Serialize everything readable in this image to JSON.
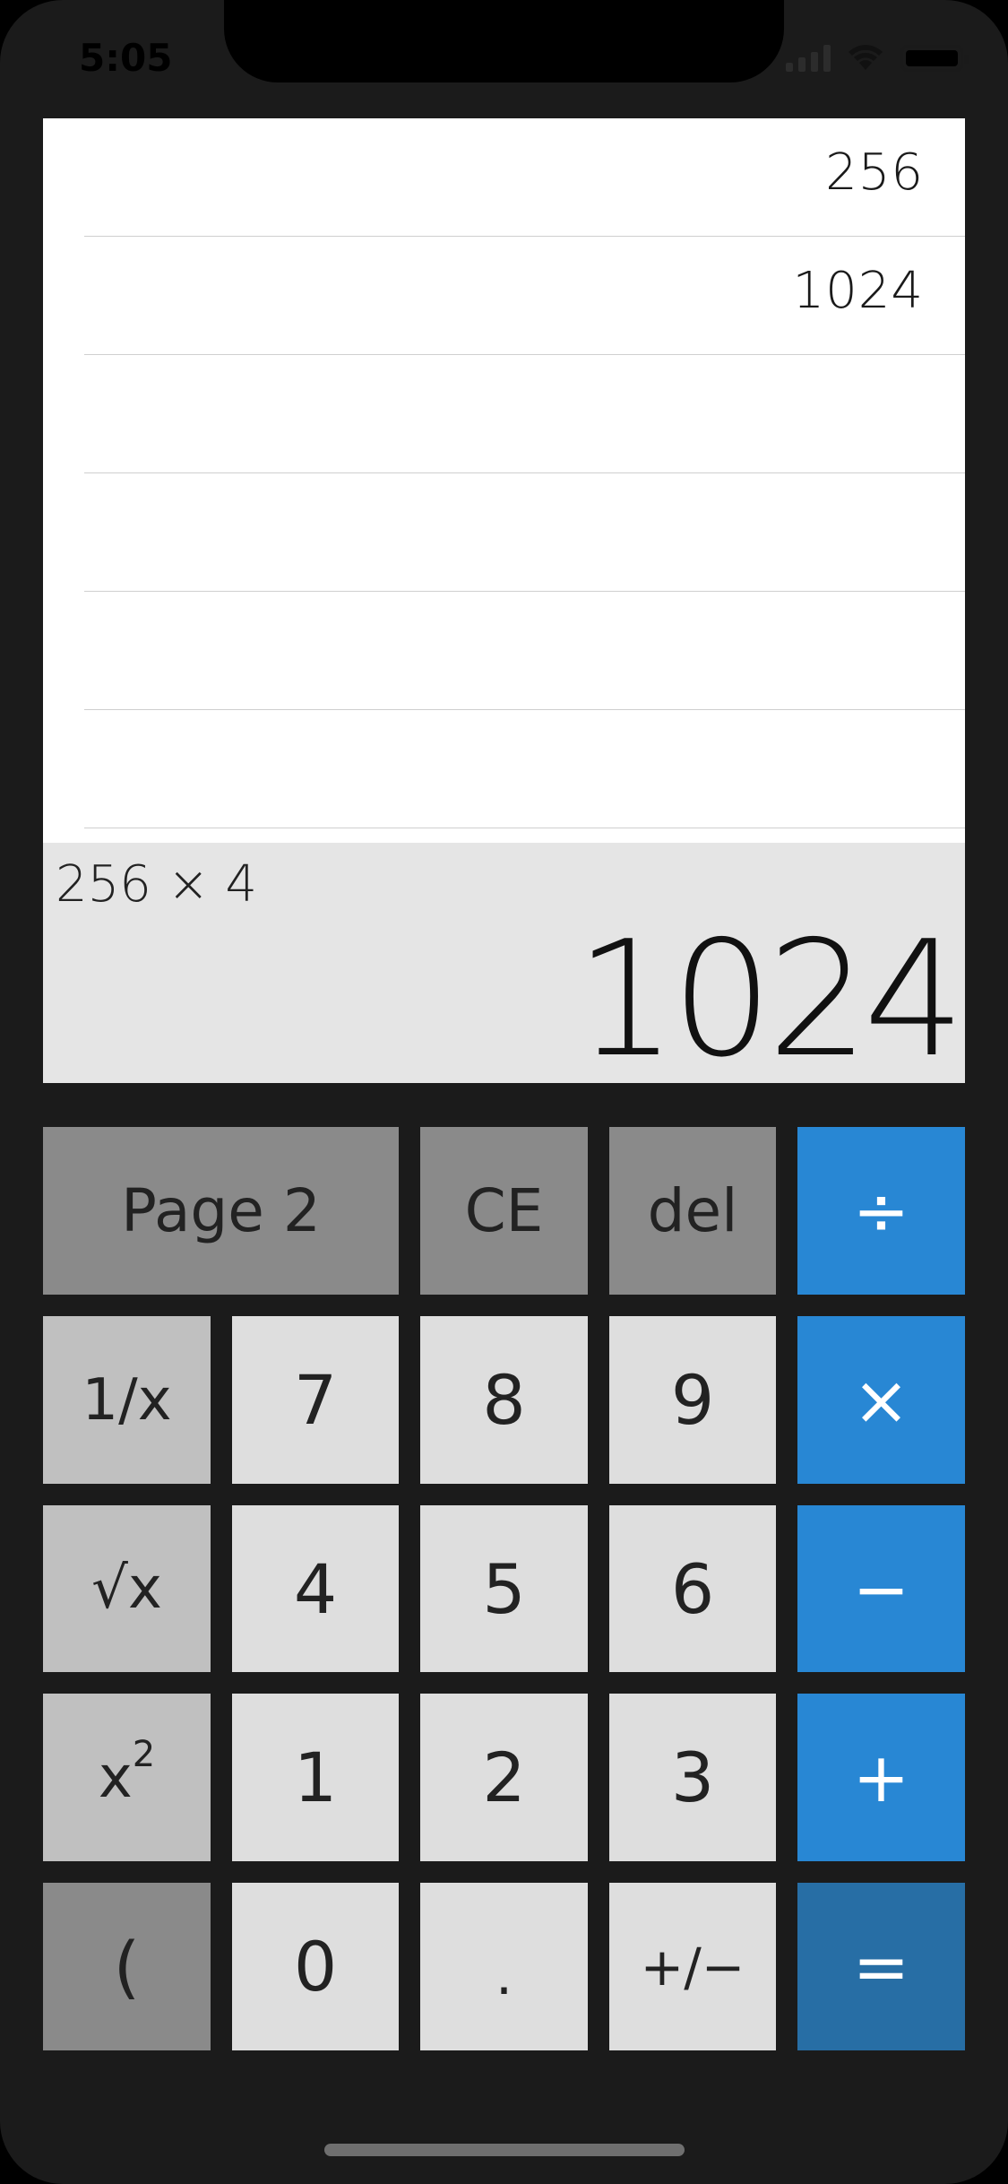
{
  "status_bar": {
    "time": "5:05"
  },
  "history": {
    "rows": [
      "256",
      "1024",
      "",
      "",
      "",
      ""
    ]
  },
  "display": {
    "expression": "256 × 4",
    "result": "1024"
  },
  "keypad": {
    "page2": "Page 2",
    "ce": "CE",
    "del": "del",
    "divide": "÷",
    "reciprocal": "1/x",
    "seven": "7",
    "eight": "8",
    "nine": "9",
    "multiply": "×",
    "sqrt": "√x",
    "four": "4",
    "five": "5",
    "six": "6",
    "minus": "−",
    "square_base": "x",
    "square_exp": "2",
    "one": "1",
    "two": "2",
    "three": "3",
    "plus": "+",
    "paren": "(",
    "zero": "0",
    "decimal": ".",
    "negate": "+/−",
    "equals": "="
  },
  "colors": {
    "operator_blue": "#2887d4",
    "equals_blue": "#276ea5",
    "function_dark": "#8a8a8a",
    "function_mid": "#c0c0c0",
    "digit_light": "#dedede"
  }
}
